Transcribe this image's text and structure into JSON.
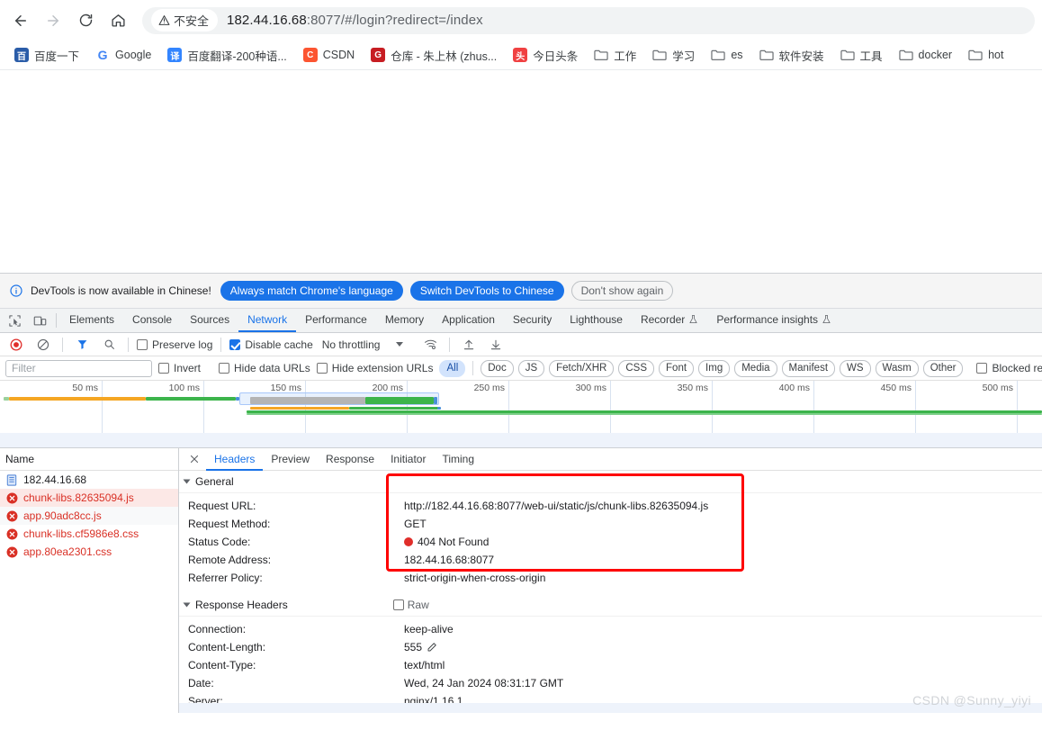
{
  "browser": {
    "nav": {
      "back_label": "Back",
      "forward_label": "Forward",
      "reload_label": "Reload",
      "home_label": "Home"
    },
    "omnibox": {
      "security_label": "不安全",
      "url_host": "182.44.16.68",
      "url_port": ":8077",
      "url_path": "/#/login?redirect=/index",
      "full_url": "182.44.16.68:8077/#/login?redirect=/index"
    },
    "bookmarks": [
      {
        "label": "百度一下",
        "icon": "baidu-icon",
        "type": "site",
        "color": "#2a5ca8"
      },
      {
        "label": "Google",
        "icon": "google-icon",
        "type": "site",
        "color": "#4285f4"
      },
      {
        "label": "百度翻译-200种语...",
        "icon": "fanyi-icon",
        "type": "site",
        "color": "#3385ff"
      },
      {
        "label": "CSDN",
        "icon": "csdn-icon",
        "type": "site",
        "color": "#fc5531"
      },
      {
        "label": "仓库 - 朱上林 (zhus...",
        "icon": "gitee-icon",
        "type": "site",
        "color": "#c71d23"
      },
      {
        "label": "今日头条",
        "icon": "toutiao-icon",
        "type": "site",
        "color": "#f04142"
      },
      {
        "label": "工作",
        "icon": "folder-icon",
        "type": "folder"
      },
      {
        "label": "学习",
        "icon": "folder-icon",
        "type": "folder"
      },
      {
        "label": "es",
        "icon": "folder-icon",
        "type": "folder"
      },
      {
        "label": "软件安装",
        "icon": "folder-icon",
        "type": "folder"
      },
      {
        "label": "工具",
        "icon": "folder-icon",
        "type": "folder"
      },
      {
        "label": "docker",
        "icon": "folder-icon",
        "type": "folder"
      },
      {
        "label": "hot",
        "icon": "folder-icon",
        "type": "folder"
      }
    ]
  },
  "devtools": {
    "infobar": {
      "message": "DevTools is now available in Chinese!",
      "btn_always": "Always match Chrome's language",
      "btn_switch": "Switch DevTools to Chinese",
      "btn_dismiss": "Don't show again"
    },
    "panels": [
      {
        "label": "Elements",
        "active": false
      },
      {
        "label": "Console",
        "active": false
      },
      {
        "label": "Sources",
        "active": false
      },
      {
        "label": "Network",
        "active": true
      },
      {
        "label": "Performance",
        "active": false
      },
      {
        "label": "Memory",
        "active": false
      },
      {
        "label": "Application",
        "active": false
      },
      {
        "label": "Security",
        "active": false
      },
      {
        "label": "Lighthouse",
        "active": false
      },
      {
        "label": "Recorder",
        "active": false,
        "badge": "flask"
      },
      {
        "label": "Performance insights",
        "active": false,
        "badge": "flask"
      }
    ],
    "network_toolbar": {
      "record_label": "Stop recording network log",
      "clear_label": "Clear network log",
      "filter_label": "Filter",
      "search_label": "Search",
      "preserve_log": {
        "label": "Preserve log",
        "checked": false
      },
      "disable_cache": {
        "label": "Disable cache",
        "checked": true
      },
      "throttling": "No throttling",
      "import_label": "Import HAR file",
      "export_label": "Export HAR file"
    },
    "filter_bar": {
      "filter_placeholder": "Filter",
      "filter_value": "",
      "invert": {
        "label": "Invert",
        "checked": false
      },
      "hide_data_urls": {
        "label": "Hide data URLs",
        "checked": false
      },
      "hide_extension_urls": {
        "label": "Hide extension URLs",
        "checked": false
      },
      "types": [
        "All",
        "Doc",
        "JS",
        "Fetch/XHR",
        "CSS",
        "Font",
        "Img",
        "Media",
        "Manifest",
        "WS",
        "Wasm",
        "Other"
      ],
      "active_type": "All",
      "blocked_cookies": {
        "label": "Blocked response cooki",
        "checked": false
      }
    },
    "overview": {
      "ticks": [
        "50 ms",
        "100 ms",
        "150 ms",
        "200 ms",
        "250 ms",
        "300 ms",
        "350 ms",
        "400 ms",
        "450 ms",
        "500 ms"
      ]
    },
    "requests": {
      "column_name": "Name",
      "rows": [
        {
          "name": "182.44.16.68",
          "status": "ok",
          "icon": "document-icon",
          "selected": false
        },
        {
          "name": "chunk-libs.82635094.js",
          "status": "error",
          "icon": "error-icon",
          "selected": true
        },
        {
          "name": "app.90adc8cc.js",
          "status": "error",
          "icon": "error-icon",
          "selected": false
        },
        {
          "name": "chunk-libs.cf5986e8.css",
          "status": "error",
          "icon": "error-icon",
          "selected": false
        },
        {
          "name": "app.80ea2301.css",
          "status": "error",
          "icon": "error-icon",
          "selected": false
        }
      ]
    },
    "detail": {
      "tabs": [
        {
          "label": "Headers",
          "active": true
        },
        {
          "label": "Preview",
          "active": false
        },
        {
          "label": "Response",
          "active": false
        },
        {
          "label": "Initiator",
          "active": false
        },
        {
          "label": "Timing",
          "active": false
        }
      ],
      "general": {
        "title": "General",
        "rows": [
          {
            "key": "Request URL:",
            "value": "http://182.44.16.68:8077/web-ui/static/js/chunk-libs.82635094.js"
          },
          {
            "key": "Request Method:",
            "value": "GET"
          },
          {
            "key": "Status Code:",
            "value": "404 Not Found",
            "dot": "#e02e2a"
          },
          {
            "key": "Remote Address:",
            "value": "182.44.16.68:8077"
          },
          {
            "key": "Referrer Policy:",
            "value": "strict-origin-when-cross-origin"
          }
        ]
      },
      "response_headers": {
        "title": "Response Headers",
        "raw_label": "Raw",
        "raw_checked": false,
        "rows": [
          {
            "key": "Connection:",
            "value": "keep-alive"
          },
          {
            "key": "Content-Length:",
            "value": "555",
            "editable": true
          },
          {
            "key": "Content-Type:",
            "value": "text/html"
          },
          {
            "key": "Date:",
            "value": "Wed, 24 Jan 2024 08:31:17 GMT"
          },
          {
            "key": "Server:",
            "value": "nginx/1.16.1"
          }
        ]
      }
    }
  },
  "watermark": "CSDN @Sunny_yiyi",
  "colors": {
    "accent": "#1a73e8",
    "error": "#d93025",
    "highlight_box": "#fe0000",
    "selected_row": "#fce8e6"
  }
}
